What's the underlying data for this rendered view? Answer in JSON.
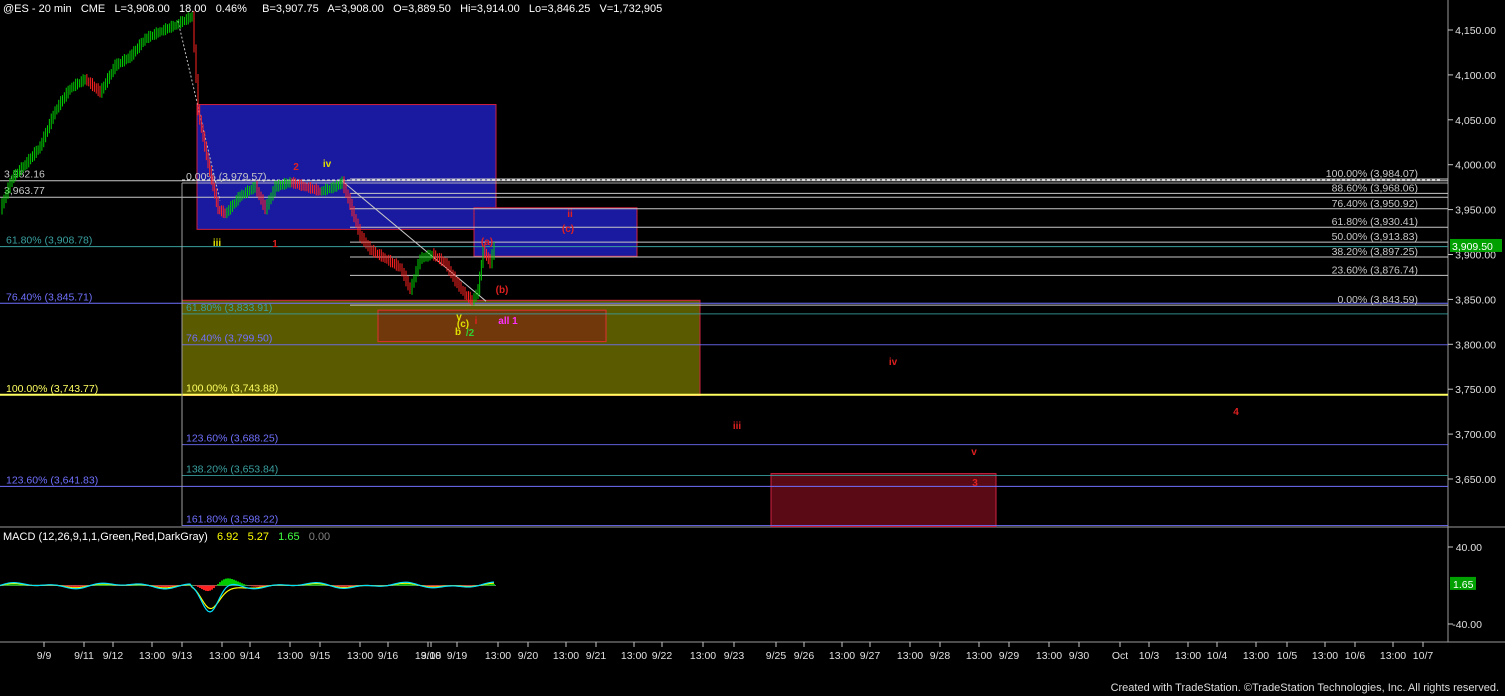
{
  "header": {
    "symbol": "@ES - 20 min",
    "exchange": "CME",
    "last": "L=3,908.00",
    "change": "18.00",
    "change_pct": "0.46%",
    "bid": "B=3,907.75",
    "ask": "A=3,908.00",
    "open": "O=3,889.50",
    "high": "Hi=3,914.00",
    "low": "Lo=3,846.25",
    "volume": "V=1,732,905"
  },
  "macd_label": {
    "name": "MACD (12,26,9,1,1,Green,Red,DarkGray)",
    "v1": "6.92",
    "v2": "5.27",
    "v3": "1.65",
    "v4": "0.00"
  },
  "footer": "Created with TradeStation. ©TradeStation Technologies, Inc. All rights reserved.",
  "colors": {
    "background": "#000000",
    "up_bar": "#00cc00",
    "down_bar": "#ff2222",
    "blue_box": "#1a1aa0",
    "olive_box": "#5a5a00",
    "red_box": "#5a0a14",
    "wave_red": "#e02020",
    "wave_yellow": "#e0e000",
    "wave_green": "#30d030",
    "wave_magenta": "#ff30ff"
  },
  "chart_data": {
    "type": "line",
    "price_axis": {
      "ticks": [
        "4,150.00",
        "4,100.00",
        "4,050.00",
        "4,000.00",
        "3,950.00",
        "3,900.00",
        "3,850.00",
        "3,800.00",
        "3,750.00",
        "3,700.00",
        "3,650.00"
      ],
      "tick_values": [
        4150,
        4100,
        4050,
        4000,
        3950,
        3900,
        3850,
        3800,
        3750,
        3700,
        3650
      ],
      "current_price_tag": "3,909.50",
      "current_price": 3909.5
    },
    "macd_axis": {
      "ticks": [
        "40.00",
        "-40.00"
      ],
      "tick_values": [
        40,
        -40
      ],
      "current_tag": "1.65",
      "current_value": 1.65
    },
    "time_axis": {
      "labels": [
        "9/9",
        "9/11",
        "9/12",
        "13:00",
        "9/13",
        "13:00",
        "9/14",
        "13:00",
        "9/15",
        "13:00",
        "9/16",
        "13:00",
        "9/18",
        "9/19",
        "13:00",
        "9/20",
        "13:00",
        "9/21",
        "13:00",
        "9/22",
        "13:00",
        "9/23",
        "9/25",
        "9/26",
        "13:00",
        "9/27",
        "13:00",
        "9/28",
        "13:00",
        "9/29",
        "13:00",
        "9/30",
        "Oct",
        "10/3",
        "13:00",
        "10/4",
        "13:00",
        "10/5",
        "13:00",
        "10/6",
        "13:00",
        "10/7"
      ]
    },
    "price_path": [
      [
        0,
        3950
      ],
      [
        12,
        3985
      ],
      [
        25,
        4000
      ],
      [
        40,
        4020
      ],
      [
        55,
        4060
      ],
      [
        70,
        4085
      ],
      [
        85,
        4095
      ],
      [
        100,
        4080
      ],
      [
        115,
        4110
      ],
      [
        130,
        4120
      ],
      [
        145,
        4140
      ],
      [
        160,
        4148
      ],
      [
        175,
        4155
      ],
      [
        192,
        4165
      ],
      [
        198,
        4060
      ],
      [
        203,
        4030
      ],
      [
        208,
        4000
      ],
      [
        213,
        3975
      ],
      [
        218,
        3950
      ],
      [
        225,
        3945
      ],
      [
        240,
        3965
      ],
      [
        255,
        3975
      ],
      [
        265,
        3950
      ],
      [
        275,
        3975
      ],
      [
        290,
        3980
      ],
      [
        305,
        3975
      ],
      [
        320,
        3970
      ],
      [
        335,
        3975
      ],
      [
        342,
        3980
      ],
      [
        350,
        3955
      ],
      [
        360,
        3920
      ],
      [
        370,
        3905
      ],
      [
        385,
        3895
      ],
      [
        400,
        3885
      ],
      [
        410,
        3860
      ],
      [
        420,
        3895
      ],
      [
        432,
        3900
      ],
      [
        445,
        3890
      ],
      [
        455,
        3870
      ],
      [
        465,
        3855
      ],
      [
        472,
        3848
      ],
      [
        478,
        3860
      ],
      [
        483,
        3905
      ],
      [
        490,
        3890
      ],
      [
        494,
        3908
      ]
    ],
    "levels_left": [
      {
        "label": "3,982.16",
        "value": 3982.16
      },
      {
        "label": "3,963.77",
        "value": 3963.77
      },
      {
        "label": "61.80% (3,908.78)",
        "value": 3908.78
      },
      {
        "label": "76.40% (3,845.71)",
        "value": 3845.71
      },
      {
        "label": "100.00% (3,743.77)",
        "value": 3743.77
      },
      {
        "label": "123.60% (3,641.83)",
        "value": 3641.83
      }
    ],
    "levels_mid": [
      {
        "label": "0.00% (3,979.57)",
        "value": 3979.57
      },
      {
        "label": "61.80% (3,833.91)",
        "value": 3833.91
      },
      {
        "label": "76.40% (3,799.50)",
        "value": 3799.5
      },
      {
        "label": "100.00% (3,743.88)",
        "value": 3743.88
      },
      {
        "label": "123.60% (3,688.25)",
        "value": 3688.25
      },
      {
        "label": "138.20% (3,653.84)",
        "value": 3653.84
      },
      {
        "label": "161.80% (3,598.22)",
        "value": 3598.22
      }
    ],
    "levels_right": [
      {
        "label": "100.00% (3,984.07)",
        "value": 3984.07
      },
      {
        "label": "88.60% (3,968.06)",
        "value": 3968.06
      },
      {
        "label": "76.40% (3,950.92)",
        "value": 3950.92
      },
      {
        "label": "61.80% (3,930.41)",
        "value": 3930.41
      },
      {
        "label": "50.00% (3,913.83)",
        "value": 3913.83
      },
      {
        "label": "38.20% (3,897.25)",
        "value": 3897.25
      },
      {
        "label": "23.60% (3,876.74)",
        "value": 3876.74
      },
      {
        "label": "0.00% (3,843.59)",
        "value": 3843.59
      }
    ],
    "wave_labels": [
      {
        "text": "2",
        "color": "red"
      },
      {
        "text": "iv",
        "color": "yellow"
      },
      {
        "text": "iii",
        "color": "yellow"
      },
      {
        "text": "1",
        "color": "red"
      },
      {
        "text": "ii",
        "color": "red"
      },
      {
        "text": "(c)",
        "color": "red"
      },
      {
        "text": "(a)",
        "color": "red"
      },
      {
        "text": "(b)",
        "color": "red"
      },
      {
        "text": "v",
        "color": "yellow"
      },
      {
        "text": "(c)",
        "color": "yellow"
      },
      {
        "text": "b",
        "color": "yellow"
      },
      {
        "text": "i",
        "color": "red"
      },
      {
        "text": "/2",
        "color": "green"
      },
      {
        "text": "all 1",
        "color": "magenta"
      },
      {
        "text": "iv",
        "color": "red"
      },
      {
        "text": "iii",
        "color": "red"
      },
      {
        "text": "4",
        "color": "red"
      },
      {
        "text": "v",
        "color": "red"
      },
      {
        "text": "3",
        "color": "red"
      }
    ]
  }
}
